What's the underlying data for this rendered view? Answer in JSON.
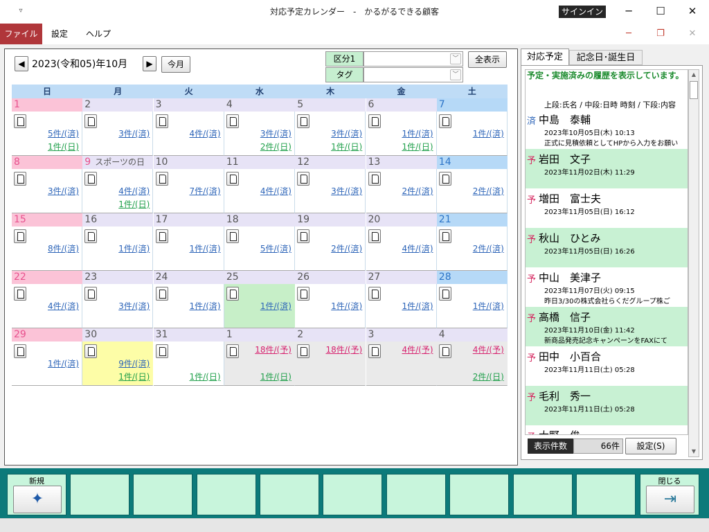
{
  "window": {
    "title": "対応予定カレンダー　-　かるがるできる顧客",
    "signin": "サインイン",
    "qat_icon": "▿",
    "min": "─",
    "max": "☐",
    "close": "✕"
  },
  "menu": {
    "file": "ファイル",
    "settings": "設定",
    "help": "ヘルプ",
    "mdi_min": "─",
    "mdi_restore": "❐",
    "mdi_close": "✕"
  },
  "toolbar": {
    "prev": "◀",
    "next": "▶",
    "month": "2023(令和05)年10月",
    "today": "今月",
    "filter1_label": "区分1",
    "filter1_value": "",
    "tag_label": "タグ",
    "tag_value": "",
    "show_all": "全表示",
    "combo_arrow": "﹀"
  },
  "weekdays": [
    "日",
    "月",
    "火",
    "水",
    "木",
    "金",
    "土"
  ],
  "weeks": [
    [
      {
        "d": "1",
        "t": "sun",
        "l1": "5件/(済)",
        "l2": "1件/(日)"
      },
      {
        "d": "2",
        "l1": "3件/(済)"
      },
      {
        "d": "3",
        "l1": "4件/(済)"
      },
      {
        "d": "4",
        "l1": "3件/(済)",
        "l2": "2件/(日)"
      },
      {
        "d": "5",
        "l1": "3件/(済)",
        "l2": "1件/(日)"
      },
      {
        "d": "6",
        "l1": "1件/(済)",
        "l2": "1件/(日)"
      },
      {
        "d": "7",
        "t": "sat",
        "l1": "1件/(済)"
      }
    ],
    [
      {
        "d": "8",
        "t": "sun",
        "l1": "3件/(済)"
      },
      {
        "d": "9",
        "t": "hol",
        "h": "スポーツの日",
        "l1": "4件/(済)",
        "l2": "1件/(日)",
        "hol_day_color": "mon"
      },
      {
        "d": "10",
        "l1": "7件/(済)"
      },
      {
        "d": "11",
        "l1": "4件/(済)"
      },
      {
        "d": "12",
        "l1": "3件/(済)"
      },
      {
        "d": "13",
        "l1": "2件/(済)"
      },
      {
        "d": "14",
        "t": "sat",
        "l1": "2件/(済)"
      }
    ],
    [
      {
        "d": "15",
        "t": "sun",
        "l1": "8件/(済)"
      },
      {
        "d": "16",
        "l1": "1件/(済)"
      },
      {
        "d": "17",
        "l1": "1件/(済)"
      },
      {
        "d": "18",
        "l1": "5件/(済)"
      },
      {
        "d": "19",
        "l1": "2件/(済)"
      },
      {
        "d": "20",
        "l1": "4件/(済)"
      },
      {
        "d": "21",
        "t": "sat",
        "l1": "2件/(済)"
      }
    ],
    [
      {
        "d": "22",
        "t": "sun",
        "l1": "4件/(済)"
      },
      {
        "d": "23",
        "l1": "3件/(済)"
      },
      {
        "d": "24",
        "l1": "1件/(済)"
      },
      {
        "d": "25",
        "l1": "1件/(済)",
        "bg": "green"
      },
      {
        "d": "26",
        "l1": "1件/(済)"
      },
      {
        "d": "27",
        "l1": "1件/(済)"
      },
      {
        "d": "28",
        "t": "sat",
        "l1": "1件/(済)"
      }
    ],
    [
      {
        "d": "29",
        "t": "sun",
        "l1": "1件/(済)"
      },
      {
        "d": "30",
        "l1": "9件/(済)",
        "l2": "1件/(日)",
        "bg": "yellow"
      },
      {
        "d": "31",
        "l2": "1件/(日)"
      },
      {
        "d": "1",
        "y": "18件/(予)",
        "l2": "1件/(日)",
        "bg": "gray"
      },
      {
        "d": "2",
        "y": "18件/(予)",
        "bg": "gray"
      },
      {
        "d": "3",
        "y": "4件/(予)",
        "bg": "gray"
      },
      {
        "d": "4",
        "y": "4件/(予)",
        "l2": "2件/(日)",
        "bg": "gray"
      }
    ]
  ],
  "panel": {
    "tab_schedule": "対応予定",
    "tab_anniv": "記念日･誕生日",
    "heading": "予定・実施済みの履歴を表示しています。",
    "format": "上段:氏名 / 中段:日時 時刻 / 下段:内容",
    "count_label": "表示件数",
    "count_value": "66件",
    "settings_btn": "設定(S)",
    "scroll_up": "▲",
    "scroll_down": "▼"
  },
  "items": [
    {
      "mark": "済",
      "kind": "b",
      "name": "中島　泰輔",
      "date": "2023年10月05日(木) 10:13",
      "note": "正式に見積依頼としてHPから入力をお願い",
      "bg": "w"
    },
    {
      "mark": "予",
      "kind": "r",
      "name": "岩田　文子",
      "date": "2023年11月02日(木) 11:29",
      "note": "",
      "bg": "g"
    },
    {
      "mark": "予",
      "kind": "r",
      "name": "増田　富士夫",
      "date": "2023年11月05日(日) 16:12",
      "note": "",
      "bg": "w"
    },
    {
      "mark": "予",
      "kind": "r",
      "name": "秋山　ひとみ",
      "date": "2023年11月05日(日) 16:26",
      "note": "",
      "bg": "g"
    },
    {
      "mark": "予",
      "kind": "r",
      "name": "中山　美津子",
      "date": "2023年11月07日(火) 09:15",
      "note": "昨日3/30の株式会社らくだグループ株ご",
      "bg": "w"
    },
    {
      "mark": "予",
      "kind": "r",
      "name": "高橋　信子",
      "date": "2023年11月10日(金) 11:42",
      "note": "新商品発売記念キャンペーンをFAXにて",
      "bg": "g"
    },
    {
      "mark": "予",
      "kind": "r",
      "name": "田中　小百合",
      "date": "2023年11月11日(土) 05:28",
      "note": "",
      "bg": "w"
    },
    {
      "mark": "予",
      "kind": "r",
      "name": "毛利　秀一",
      "date": "2023年11月11日(土) 05:28",
      "note": "",
      "bg": "g"
    },
    {
      "mark": "予",
      "kind": "r",
      "name": "大野　俊一",
      "date": "",
      "note": "",
      "bg": "w"
    }
  ],
  "footer": {
    "new": "新規",
    "close": "閉じる",
    "new_icon": "✦",
    "close_icon": "⇥"
  }
}
